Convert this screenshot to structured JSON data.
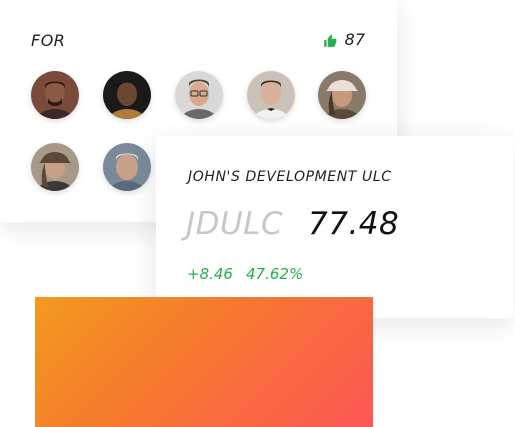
{
  "for_card": {
    "title": "FOR",
    "count": "87",
    "icon": "thumbs-up-icon",
    "icon_color": "#22b14c",
    "avatars": [
      {
        "name": "avatar-1",
        "bg": "#7a4a3a",
        "skin": "#8a5a42",
        "hair": "#2a1a12"
      },
      {
        "name": "avatar-2",
        "bg": "#1a1a1a",
        "skin": "#6b4631",
        "hair": "#111111"
      },
      {
        "name": "avatar-3",
        "bg": "#d8d8d8",
        "skin": "#d9a98a",
        "hair": "#5a4535"
      },
      {
        "name": "avatar-4",
        "bg": "#c9c2b6",
        "skin": "#d9b19a",
        "hair": "#3a2a20"
      },
      {
        "name": "avatar-5",
        "bg": "#8a7a6a",
        "skin": "#c99a7a",
        "hair": "#4a3828"
      },
      {
        "name": "avatar-6",
        "bg": "#a89888",
        "skin": "#c8a088",
        "hair": "#5a4838"
      },
      {
        "name": "avatar-7",
        "bg": "#7a8a9a",
        "skin": "#c9a08a",
        "hair": "#e8e8e8"
      }
    ]
  },
  "stock": {
    "company": "JOHN'S DEVELOPMENT ULC",
    "ticker": "JDULC",
    "price": "77.48",
    "change_abs": "+8.46",
    "change_pct": "47.62%",
    "positive_color": "#22b14c"
  },
  "gradient": {
    "from": "#f29a1e",
    "to": "#fd5756"
  }
}
